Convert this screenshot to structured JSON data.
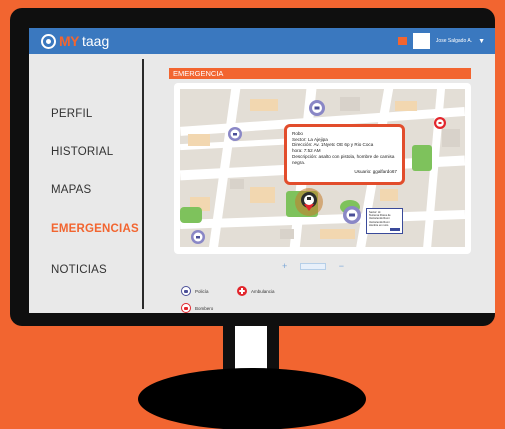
{
  "app": {
    "brand_my": "MY",
    "brand_rest": "taag",
    "user_name": "Jose Salgado A.",
    "accent_color": "#f26530",
    "topbar_color": "#3a78bf"
  },
  "sidebar": {
    "items": [
      {
        "label": "PERFIL",
        "active": false
      },
      {
        "label": "HISTORIAL",
        "active": false
      },
      {
        "label": "MAPAS",
        "active": false
      },
      {
        "label": "EMERGENCIAS",
        "active": true
      },
      {
        "label": "NOTICIAS",
        "active": false
      }
    ]
  },
  "main": {
    "section_title": "EMERGENCIA",
    "popup": {
      "type": "Robo",
      "sector": "Sector: La Ajejipa",
      "direccion": "Dirección: Av. 1Nyetc OE 6p y Rio Coca",
      "hora": "hora: 7:52 AM",
      "descripcion": "Descripción: asalto con pistola, hombre de camisa negra.",
      "usuario": "Usuario: ggalfardo67"
    },
    "mini_card": {
      "lines": [
        "Sector: Hi",
        "Teorema Flores de",
        "Vectoriendo Rumi",
        "Vectoriendo Rumi",
        "Hombre en moto"
      ]
    },
    "zoom": {
      "plus": "+",
      "minus": "−"
    }
  },
  "legend": {
    "police": "Policía",
    "ambulance": "Ambulancia",
    "firefighter": "Bombero"
  },
  "icons": [
    "police-icon",
    "ambulance-icon",
    "firefighter-icon",
    "map-pin-icon",
    "notification-icon",
    "chevron-down-icon"
  ]
}
